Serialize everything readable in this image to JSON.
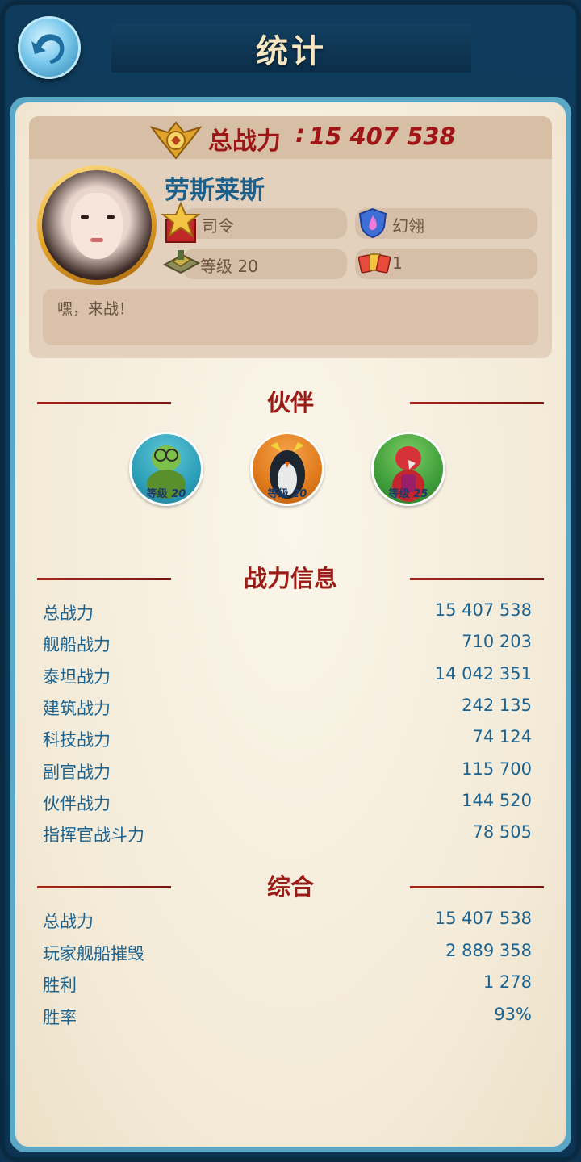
{
  "header": {
    "title": "统计",
    "back_icon": "back-arrow-icon"
  },
  "profile": {
    "power_label": "总战力",
    "power_colon": ":",
    "power_value": "15 407 538",
    "name": "劳斯莱斯",
    "rank": "司令",
    "guild": "幻翎",
    "level": "等级 20",
    "cards": "1",
    "motto": "嘿，来战！"
  },
  "partners": {
    "title": "伙伴",
    "items": [
      {
        "level_label": "等级",
        "level": "20",
        "icon": "turtle-partner-icon",
        "bg": "#2d9fb8"
      },
      {
        "level_label": "等级",
        "level": "20",
        "icon": "penguin-partner-icon",
        "bg": "#e07a1c"
      },
      {
        "level_label": "等级",
        "level": "25",
        "icon": "parrot-partner-icon",
        "bg": "#3f9e3a"
      }
    ]
  },
  "power_info": {
    "title": "战力信息",
    "rows": [
      {
        "label": "总战力",
        "value": "15 407 538"
      },
      {
        "label": "舰船战力",
        "value": "710 203"
      },
      {
        "label": "泰坦战力",
        "value": "14 042 351"
      },
      {
        "label": "建筑战力",
        "value": "242 135"
      },
      {
        "label": "科技战力",
        "value": "74 124"
      },
      {
        "label": "副官战力",
        "value": "115 700"
      },
      {
        "label": "伙伴战力",
        "value": "144 520"
      },
      {
        "label": "指挥官战斗力",
        "value": "78 505"
      }
    ]
  },
  "overall": {
    "title": "综合",
    "rows": [
      {
        "label": "总战力",
        "value": "15 407 538"
      },
      {
        "label": "玩家舰船摧毁",
        "value": "2 889 358"
      },
      {
        "label": "胜利",
        "value": "1 278"
      },
      {
        "label": "胜率",
        "value": "93%"
      }
    ]
  },
  "colors": {
    "accent_red": "#9b1b16",
    "stat_blue": "#1d6390",
    "frame_blue": "#0f3c5c"
  }
}
